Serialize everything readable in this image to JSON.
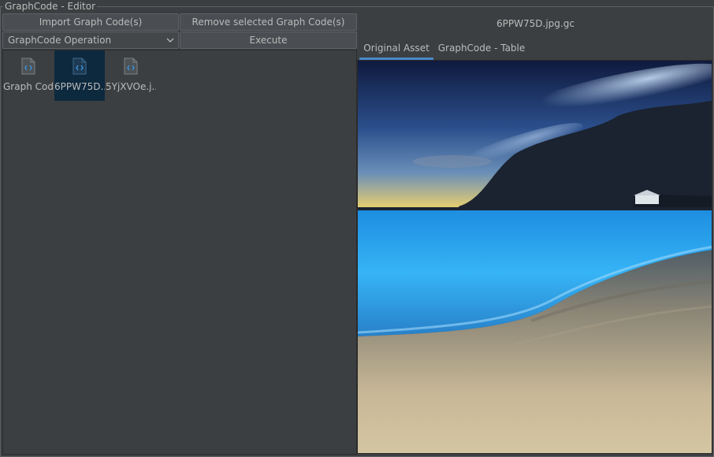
{
  "window": {
    "title": "GraphCode - Editor"
  },
  "toolbar": {
    "import_label": "Import Graph Code(s)",
    "remove_label": "Remove selected Graph Code(s)",
    "operation_value": "GraphCode Operation",
    "execute_label": "Execute"
  },
  "files": [
    {
      "name": "Graph Code",
      "selected": false
    },
    {
      "name": "6PPW75D....",
      "selected": true
    },
    {
      "name": "5YjXVOe.j...",
      "selected": false
    }
  ],
  "preview": {
    "asset_title": "6PPW75D.jpg.gc",
    "tabs": [
      {
        "label": "Original Asset",
        "active": true
      },
      {
        "label": "GraphCode - Table",
        "active": false
      }
    ]
  },
  "colors": {
    "background": "#3c3f41",
    "selection": "#0d293e",
    "accent": "#4a88c7",
    "icon": "#3d8fd6"
  },
  "icons": {
    "file": "code-file-icon",
    "dropdown": "chevron-down-icon"
  }
}
